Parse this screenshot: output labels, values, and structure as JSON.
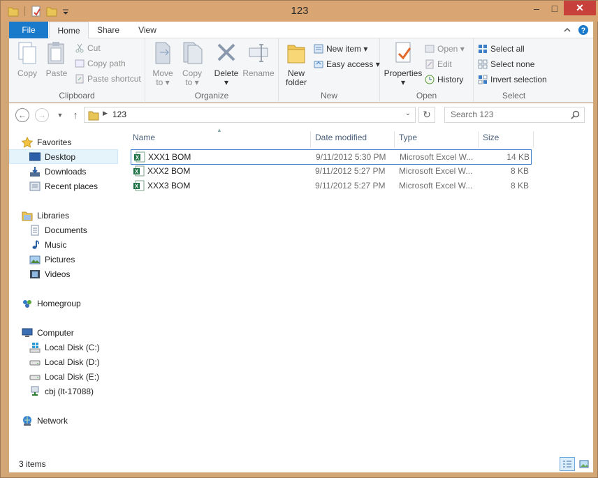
{
  "window": {
    "title": "123",
    "minimize": "–",
    "maximize": "□",
    "close": "✕"
  },
  "tabs": {
    "file": "File",
    "home": "Home",
    "share": "Share",
    "view": "View"
  },
  "ribbon": {
    "clipboard": {
      "label": "Clipboard",
      "copy": "Copy",
      "paste": "Paste",
      "cut": "Cut",
      "copy_path": "Copy path",
      "paste_shortcut": "Paste shortcut"
    },
    "organize": {
      "label": "Organize",
      "move_to": "Move",
      "move_to2": "to",
      "copy_to": "Copy",
      "copy_to2": "to",
      "delete": "Delete",
      "rename": "Rename"
    },
    "new": {
      "label": "New",
      "new_folder": "New",
      "new_folder2": "folder",
      "new_item": "New item",
      "easy_access": "Easy access"
    },
    "open": {
      "label": "Open",
      "properties": "Properties",
      "open": "Open",
      "edit": "Edit",
      "history": "History"
    },
    "select": {
      "label": "Select",
      "select_all": "Select all",
      "select_none": "Select none",
      "invert": "Invert selection"
    }
  },
  "address": {
    "path": "123",
    "search_placeholder": "Search 123"
  },
  "nav": {
    "favorites": "Favorites",
    "desktop": "Desktop",
    "downloads": "Downloads",
    "recent": "Recent places",
    "libraries": "Libraries",
    "documents": "Documents",
    "music": "Music",
    "pictures": "Pictures",
    "videos": "Videos",
    "homegroup": "Homegroup",
    "computer": "Computer",
    "disk_c": "Local Disk (C:)",
    "disk_d": "Local Disk (D:)",
    "disk_e": "Local Disk (E:)",
    "cbj": "cbj (lt-17088)",
    "network": "Network"
  },
  "columns": {
    "name": "Name",
    "date": "Date modified",
    "type": "Type",
    "size": "Size"
  },
  "files": [
    {
      "name": "XXX1 BOM",
      "date": "9/11/2012 5:30 PM",
      "type": "Microsoft Excel W...",
      "size": "14 KB"
    },
    {
      "name": "XXX2 BOM",
      "date": "9/11/2012 5:27 PM",
      "type": "Microsoft Excel W...",
      "size": "8 KB"
    },
    {
      "name": "XXX3 BOM",
      "date": "9/11/2012 5:27 PM",
      "type": "Microsoft Excel W...",
      "size": "8 KB"
    }
  ],
  "status": {
    "count": "3 items"
  },
  "colors": {
    "accent": "#1979ca",
    "selection": "#3b7ec6",
    "excel": "#1e7145"
  }
}
